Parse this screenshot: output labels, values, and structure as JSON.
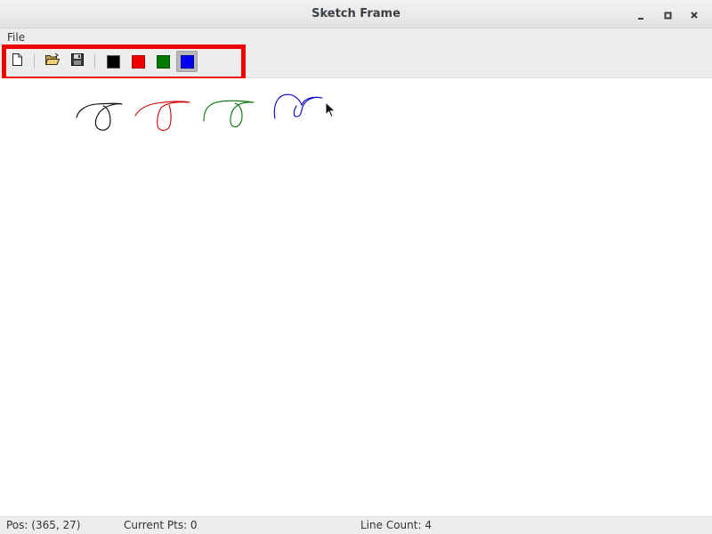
{
  "window": {
    "title": "Sketch Frame",
    "controls": [
      "minimize-icon",
      "maximize-icon",
      "close-icon"
    ]
  },
  "menubar": {
    "items": [
      {
        "label": "File"
      }
    ]
  },
  "toolbar": {
    "buttons": [
      {
        "name": "new",
        "icon": "new-document-icon"
      },
      {
        "name": "open",
        "icon": "open-folder-icon"
      },
      {
        "name": "save",
        "icon": "floppy-disk-icon"
      }
    ],
    "colors": [
      {
        "name": "black",
        "color": "#000000",
        "selected": false
      },
      {
        "name": "red",
        "color": "#ee0000",
        "selected": false
      },
      {
        "name": "green",
        "color": "#007a00",
        "selected": false
      },
      {
        "name": "blue",
        "color": "#0000ee",
        "selected": true
      }
    ],
    "annotation_color": "#ee0000"
  },
  "canvas": {
    "strokes": [
      {
        "color": "#000000"
      },
      {
        "color": "#d00000"
      },
      {
        "color": "#007000"
      },
      {
        "color": "#0000c0"
      }
    ]
  },
  "statusbar": {
    "pos": "Pos: (365, 27)",
    "current_pts": "Current Pts: 0",
    "line_count": "Line Count: 4"
  }
}
